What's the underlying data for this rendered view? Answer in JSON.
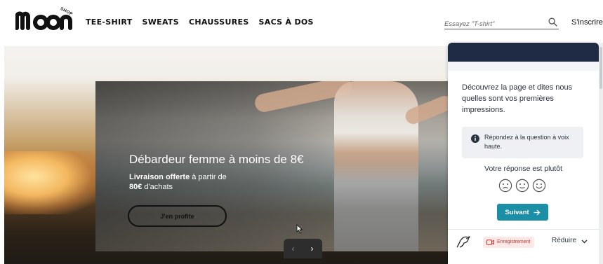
{
  "brand": {
    "logo_text": "moon",
    "logo_tag": "SHOP"
  },
  "nav": {
    "items": [
      {
        "label": "TEE-SHIRT"
      },
      {
        "label": "SWEATS"
      },
      {
        "label": "CHAUSSURES"
      },
      {
        "label": "SACS À DOS"
      }
    ]
  },
  "search": {
    "placeholder": "Essayez \"T-shirt\"",
    "icon": "search-icon"
  },
  "account": {
    "signin_label": "S'inscrire"
  },
  "hero": {
    "title": "Débardeur femme à moins de 8€",
    "subtitle_bold": "Livraison offerte",
    "subtitle_rest": " à partir de",
    "subtitle_bold2": "80€",
    "subtitle_rest2": " d'achats",
    "cta_label": "J'en profite",
    "prev_label": "‹",
    "next_label": "›"
  },
  "feedback": {
    "intro": "Découvrez la page et dites nous quelles sont vos premières impressions.",
    "info": "Répondez à la question à voix haute.",
    "question": "Votre réponse est plutôt",
    "faces": [
      "sad-face-icon",
      "neutral-face-icon",
      "happy-face-icon"
    ],
    "next_label": "Suivant",
    "recording_label": "Enregistrement",
    "reduce_label": "Réduire"
  },
  "colors": {
    "panel_header": "#1f2a44",
    "accent": "#1b8fa6",
    "recording": "#c0392b"
  }
}
